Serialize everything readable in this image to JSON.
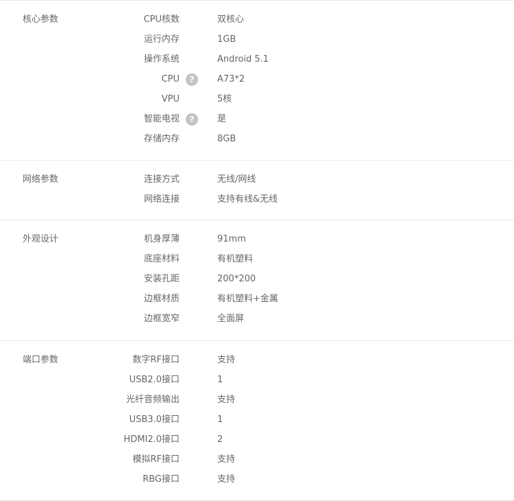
{
  "sections": [
    {
      "title": "核心参数",
      "rows": [
        {
          "label": "CPU核数",
          "value": "双核心",
          "help": false
        },
        {
          "label": "运行内存",
          "value": "1GB",
          "help": false
        },
        {
          "label": "操作系统",
          "value": "Android 5.1",
          "help": false
        },
        {
          "label": "CPU",
          "value": "A73*2",
          "help": true
        },
        {
          "label": "VPU",
          "value": "5核",
          "help": false
        },
        {
          "label": "智能电视",
          "value": "是",
          "help": true
        },
        {
          "label": "存储内存",
          "value": "8GB",
          "help": false
        }
      ]
    },
    {
      "title": "网络参数",
      "rows": [
        {
          "label": "连接方式",
          "value": "无线/网线",
          "help": false
        },
        {
          "label": "网络连接",
          "value": "支持有线&无线",
          "help": false
        }
      ]
    },
    {
      "title": "外观设计",
      "rows": [
        {
          "label": "机身厚薄",
          "value": "91mm",
          "help": false
        },
        {
          "label": "底座材料",
          "value": "有机塑料",
          "help": false
        },
        {
          "label": "安装孔距",
          "value": "200*200",
          "help": false
        },
        {
          "label": "边框材质",
          "value": "有机塑料+金属",
          "help": false
        },
        {
          "label": "边框宽窄",
          "value": "全面屏",
          "help": false
        }
      ]
    },
    {
      "title": "端口参数",
      "rows": [
        {
          "label": "数字RF接口",
          "value": "支持",
          "help": false
        },
        {
          "label": "USB2.0接口",
          "value": "1",
          "help": false
        },
        {
          "label": "光纤音频输出",
          "value": "支持",
          "help": false
        },
        {
          "label": "USB3.0接口",
          "value": "1",
          "help": false
        },
        {
          "label": "HDMI2.0接口",
          "value": "2",
          "help": false
        },
        {
          "label": "模拟RF接口",
          "value": "支持",
          "help": false
        },
        {
          "label": "RBG接口",
          "value": "支持",
          "help": false
        }
      ]
    }
  ],
  "help_icon": {
    "name": "question-circle-icon",
    "glyph": "?"
  },
  "colors": {
    "text": "#666666",
    "divider": "#e8e8e8",
    "icon_bg": "#c4c4c4"
  }
}
